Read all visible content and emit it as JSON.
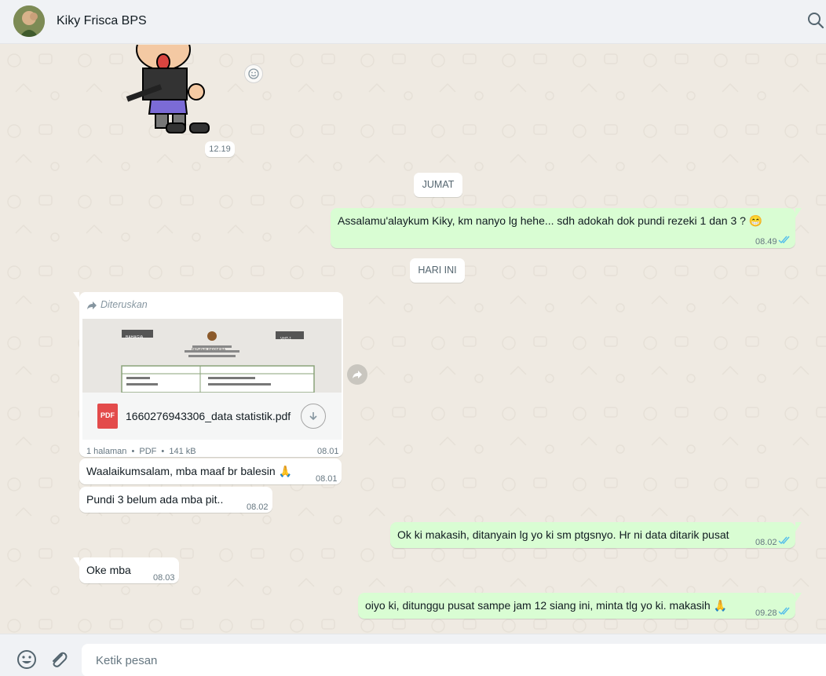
{
  "header": {
    "contact_name": "Kiky Frisca BPS",
    "search_icon": "search-icon",
    "avatar": "contact-avatar"
  },
  "chat": {
    "sticker_time": "12.19",
    "day_separators": [
      "JUMAT",
      "HARI INI"
    ],
    "messages": [
      {
        "direction": "out",
        "text": "Assalamu'alaykum Kiky, km nanyo lg hehe... sdh adokah dok pundi rezeki 1 dan 3 ? 😁",
        "time": "08.49",
        "status": "read"
      },
      {
        "direction": "in",
        "forwarded_label": "Diteruskan",
        "document": {
          "file_name": "1660276943306_data statistik.pdf",
          "file_type": "PDF",
          "pages": "1 halaman",
          "size": "141 kB",
          "separator": "•",
          "preview_labels": [
            "BAHAGIA",
            "VHT-1",
            "REPUBLIK INDONESIA"
          ]
        },
        "time": "08.01"
      },
      {
        "direction": "in",
        "text": "Waalaikumsalam, mba maaf br balesin 🙏",
        "time": "08.01"
      },
      {
        "direction": "in",
        "text": "Pundi 3 belum ada mba pit..",
        "time": "08.02"
      },
      {
        "direction": "out",
        "text": "Ok ki makasih, ditanyain lg yo ki sm ptgsnyo. Hr ni data ditarik pusat",
        "time": "08.02",
        "status": "read"
      },
      {
        "direction": "in",
        "text": "Oke mba",
        "time": "08.03"
      },
      {
        "direction": "out",
        "text": "oiyo ki, ditunggu pusat sampe jam 12 siang ini, minta tlg yo ki. makasih 🙏",
        "time": "09.28",
        "status": "read"
      }
    ]
  },
  "footer": {
    "input_placeholder": "Ketik pesan",
    "emoji_icon": "emoji-icon",
    "attach_icon": "paperclip-icon"
  },
  "colors": {
    "chat_bg": "#efeae2",
    "outgoing_bubble": "#d9fdd3",
    "incoming_bubble": "#ffffff",
    "read_ticks": "#53bdeb",
    "header_bg": "#f0f2f5"
  }
}
